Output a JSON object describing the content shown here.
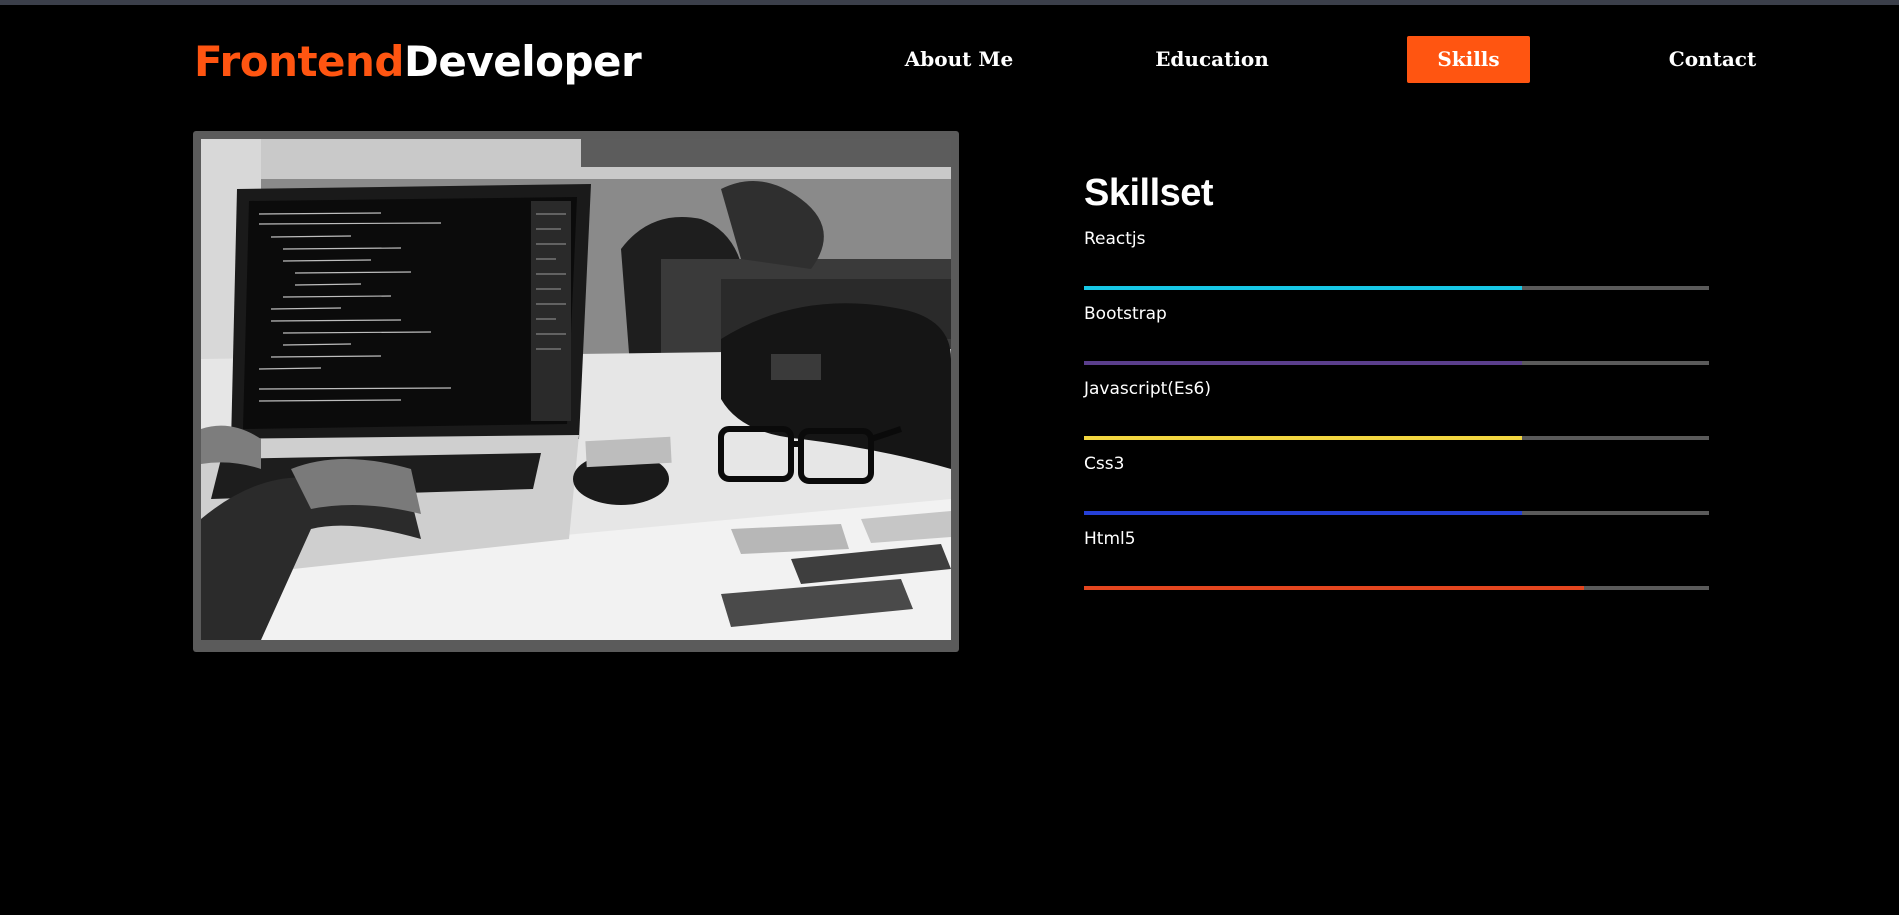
{
  "header": {
    "logo_accent": "Frontend",
    "logo_rest": "Developer",
    "nav": [
      {
        "label": "About Me"
      },
      {
        "label": "Education"
      },
      {
        "label": "Skills",
        "active": true
      },
      {
        "label": "Contact"
      }
    ]
  },
  "colors": {
    "accent": "#ff5511",
    "background": "#000000",
    "track": "#5a5a5a"
  },
  "skills": {
    "title": "Skillset",
    "items": [
      {
        "name": "Reactjs",
        "level": 0.7,
        "color": "#17c8e6"
      },
      {
        "name": "Bootstrap",
        "level": 0.7,
        "color": "#5a3e8c"
      },
      {
        "name": "Javascript(Es6)",
        "level": 0.7,
        "color": "#f2d640"
      },
      {
        "name": "Css3",
        "level": 0.7,
        "color": "#2540d8"
      },
      {
        "name": "Html5",
        "level": 0.8,
        "color": "#e5461f"
      }
    ]
  },
  "image": {
    "icon": "laptop-workspace-photo"
  }
}
